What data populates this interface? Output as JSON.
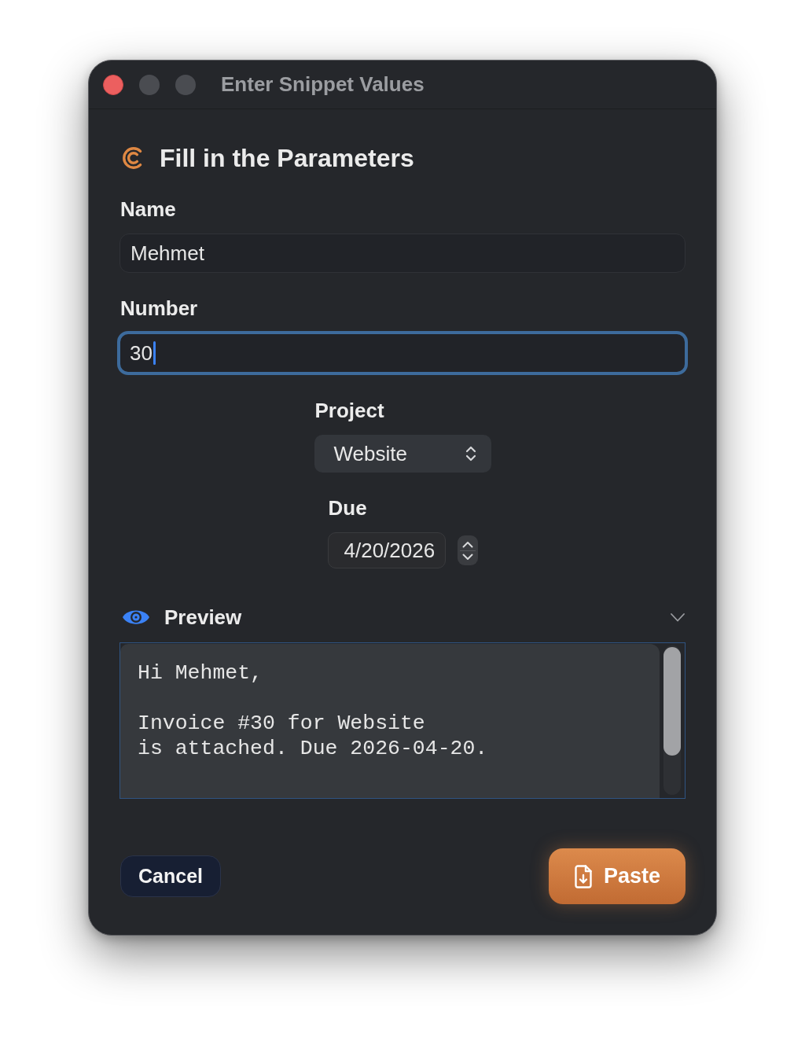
{
  "window": {
    "title": "Enter Snippet Values",
    "controls": [
      {
        "kind": "close",
        "disabled": false
      },
      {
        "kind": "minimize",
        "disabled": true
      },
      {
        "kind": "zoom",
        "disabled": true
      }
    ]
  },
  "heading": {
    "title": "Fill in the Parameters"
  },
  "fields": [
    {
      "kind": "text",
      "label": "Name",
      "value": "Mehmet",
      "focused": false
    },
    {
      "kind": "text",
      "label": "Number",
      "value": "30",
      "focused": true
    },
    {
      "kind": "select",
      "label": "Project",
      "value": "Website"
    },
    {
      "kind": "date",
      "label": "Due",
      "value": "4/20/2026"
    }
  ],
  "preview": {
    "title": "Preview",
    "expanded": true,
    "paragraphs": [
      "Hi Mehmet,",
      "Invoice #30 for Website\nis attached. Due 2026-04-20."
    ]
  },
  "buttons": [
    {
      "kind": "cancel",
      "label": "Cancel"
    },
    {
      "kind": "primary",
      "label": "Paste"
    }
  ]
}
